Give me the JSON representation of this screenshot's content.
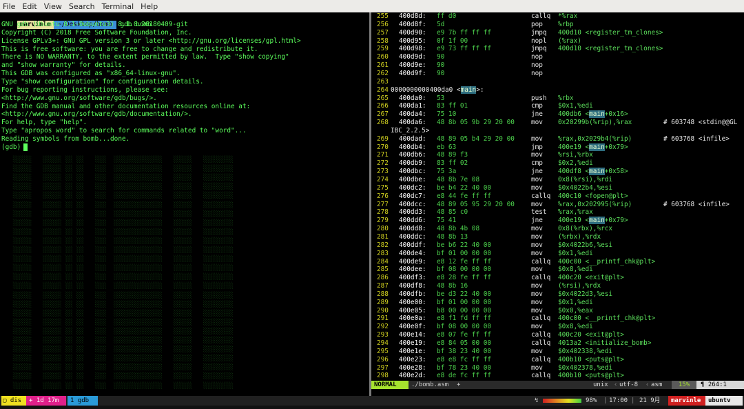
{
  "menubar": [
    "File",
    "Edit",
    "View",
    "Search",
    "Terminal",
    "Help"
  ],
  "prompt": {
    "user": "marvinle",
    "path": "~/Desktop/bomb",
    "command": "gdb bomb"
  },
  "gdb_lines": [
    "GNU gdb (Ubuntu 8.1-0ubuntu3) 8.1.0.20180409-git",
    "Copyright (C) 2018 Free Software Foundation, Inc.",
    "License GPLv3+: GNU GPL version 3 or later <http://gnu.org/licenses/gpl.html>",
    "This is free software: you are free to change and redistribute it.",
    "There is NO WARRANTY, to the extent permitted by law.  Type \"show copying\"",
    "and \"show warranty\" for details.",
    "This GDB was configured as \"x86_64-linux-gnu\".",
    "Type \"show configuration\" for configuration details.",
    "For bug reporting instructions, please see:",
    "<http://www.gnu.org/software/gdb/bugs/>.",
    "Find the GDB manual and other documentation resources online at:",
    "<http://www.gnu.org/software/gdb/documentation/>.",
    "For help, type \"help\".",
    "Type \"apropos word\" to search for commands related to \"word\"...",
    "Reading symbols from bomb...done.",
    "(gdb)"
  ],
  "asm_lines": [
    [
      "255",
      "400d8d:",
      "ff d0",
      "callq",
      "*%rax",
      ""
    ],
    [
      "256",
      "400d8f:",
      "5d",
      "pop",
      "%rbp",
      ""
    ],
    [
      "257",
      "400d90:",
      "e9 7b ff ff ff",
      "jmpq",
      "400d10 <register_tm_clones>",
      ""
    ],
    [
      "258",
      "400d95:",
      "0f 1f 00",
      "nopl",
      "(%rax)",
      ""
    ],
    [
      "259",
      "400d98:",
      "e9 73 ff ff ff",
      "jmpq",
      "400d10 <register_tm_clones>",
      ""
    ],
    [
      "260",
      "400d9d:",
      "90",
      "nop",
      "",
      ""
    ],
    [
      "261",
      "400d9e:",
      "90",
      "nop",
      "",
      ""
    ],
    [
      "262",
      "400d9f:",
      "90",
      "nop",
      "",
      ""
    ],
    [
      "263",
      "",
      "",
      "",
      "",
      ""
    ],
    [
      "264",
      "",
      "",
      "",
      "",
      ""
    ],
    [
      "265",
      "400da0:",
      "53",
      "push",
      "%rbx",
      ""
    ],
    [
      "266",
      "400da1:",
      "83 ff 01",
      "cmp",
      "$0x1,%edi",
      ""
    ],
    [
      "267",
      "400da4:",
      "75 10",
      "jne",
      "400db6 <main+0x16>",
      ""
    ],
    [
      "268",
      "400da6:",
      "48 8b 05 9b 29 20 00",
      "mov",
      "0x20299b(%rip),%rax",
      "# 603748 <stdin@@GL"
    ],
    [
      "",
      "",
      "",
      "",
      "",
      ""
    ],
    [
      "269",
      "400dad:",
      "48 89 05 b4 29 20 00",
      "mov",
      "%rax,0x2029b4(%rip)",
      "# 603768 <infile>"
    ],
    [
      "270",
      "400db4:",
      "eb 63",
      "jmp",
      "400e19 <main+0x79>",
      ""
    ],
    [
      "271",
      "400db6:",
      "48 89 f3",
      "mov",
      "%rsi,%rbx",
      ""
    ],
    [
      "272",
      "400db9:",
      "83 ff 02",
      "cmp",
      "$0x2,%edi",
      ""
    ],
    [
      "273",
      "400dbc:",
      "75 3a",
      "jne",
      "400df8 <main+0x58>",
      ""
    ],
    [
      "274",
      "400dbe:",
      "48 8b 7e 08",
      "mov",
      "0x8(%rsi),%rdi",
      ""
    ],
    [
      "275",
      "400dc2:",
      "be b4 22 40 00",
      "mov",
      "$0x4022b4,%esi",
      ""
    ],
    [
      "276",
      "400dc7:",
      "e8 44 fe ff ff",
      "callq",
      "400c10 <fopen@plt>",
      ""
    ],
    [
      "277",
      "400dcc:",
      "48 89 05 95 29 20 00",
      "mov",
      "%rax,0x202995(%rip)",
      "# 603768 <infile>"
    ],
    [
      "278",
      "400dd3:",
      "48 85 c0",
      "test",
      "%rax,%rax",
      ""
    ],
    [
      "279",
      "400dd6:",
      "75 41",
      "jne",
      "400e19 <main+0x79>",
      ""
    ],
    [
      "280",
      "400dd8:",
      "48 8b 4b 08",
      "mov",
      "0x8(%rbx),%rcx",
      ""
    ],
    [
      "281",
      "400ddc:",
      "48 8b 13",
      "mov",
      "(%rbx),%rdx",
      ""
    ],
    [
      "282",
      "400ddf:",
      "be b6 22 40 00",
      "mov",
      "$0x4022b6,%esi",
      ""
    ],
    [
      "283",
      "400de4:",
      "bf 01 00 00 00",
      "mov",
      "$0x1,%edi",
      ""
    ],
    [
      "284",
      "400de9:",
      "e8 12 fe ff ff",
      "callq",
      "400c00 <__printf_chk@plt>",
      ""
    ],
    [
      "285",
      "400dee:",
      "bf 08 00 00 00",
      "mov",
      "$0x8,%edi",
      ""
    ],
    [
      "286",
      "400df3:",
      "e8 28 fe ff ff",
      "callq",
      "400c20 <exit@plt>",
      ""
    ],
    [
      "287",
      "400df8:",
      "48 8b 16",
      "mov",
      "(%rsi),%rdx",
      ""
    ],
    [
      "288",
      "400dfb:",
      "be d3 22 40 00",
      "mov",
      "$0x4022d3,%esi",
      ""
    ],
    [
      "289",
      "400e00:",
      "bf 01 00 00 00",
      "mov",
      "$0x1,%edi",
      ""
    ],
    [
      "290",
      "400e05:",
      "b8 00 00 00 00",
      "mov",
      "$0x0,%eax",
      ""
    ],
    [
      "291",
      "400e0a:",
      "e8 f1 fd ff ff",
      "callq",
      "400c00 <__printf_chk@plt>",
      ""
    ],
    [
      "292",
      "400e0f:",
      "bf 08 00 00 00",
      "mov",
      "$0x8,%edi",
      ""
    ],
    [
      "293",
      "400e14:",
      "e8 07 fe ff ff",
      "callq",
      "400c20 <exit@plt>",
      ""
    ],
    [
      "294",
      "400e19:",
      "e8 84 05 00 00",
      "callq",
      "4013a2 <initialize_bomb>",
      ""
    ],
    [
      "295",
      "400e1e:",
      "bf 38 23 40 00",
      "mov",
      "$0x402338,%edi",
      ""
    ],
    [
      "296",
      "400e23:",
      "e8 e8 fc ff ff",
      "callq",
      "400b10 <puts@plt>",
      ""
    ],
    [
      "297",
      "400e28:",
      "bf 78 23 40 00",
      "mov",
      "$0x402378,%edi",
      ""
    ],
    [
      "298",
      "400e2d:",
      "e8 de fc ff ff",
      "callq",
      "400b10 <puts@plt>",
      ""
    ]
  ],
  "asm_special": {
    "label_264": "0000000000400da0 <main>:",
    "wrap_268": "IBC_2.2.5>"
  },
  "vim_status": {
    "mode": "NORMAL",
    "file": "./bomb.asm",
    "modified": "+",
    "fileformat": "unix",
    "encoding": "utf-8",
    "filetype": "asm",
    "percent": "15%",
    "position": "264:1"
  },
  "tmux": {
    "sess1": "dis",
    "sess2": "+ 1d 17m",
    "win": "1 gdb",
    "battery": "98%",
    "time": "17:00",
    "date": "21 9月",
    "host": "marvinle",
    "os": "ubuntv"
  },
  "colors": {
    "terminal_green": "#5cff5c",
    "vim_mode_bg": "#a6e22e",
    "tmux_red": "#d02020",
    "tmux_pink": "#e0208a",
    "tmux_blue": "#2a9ad8",
    "tmux_yellow": "#f0e020"
  }
}
